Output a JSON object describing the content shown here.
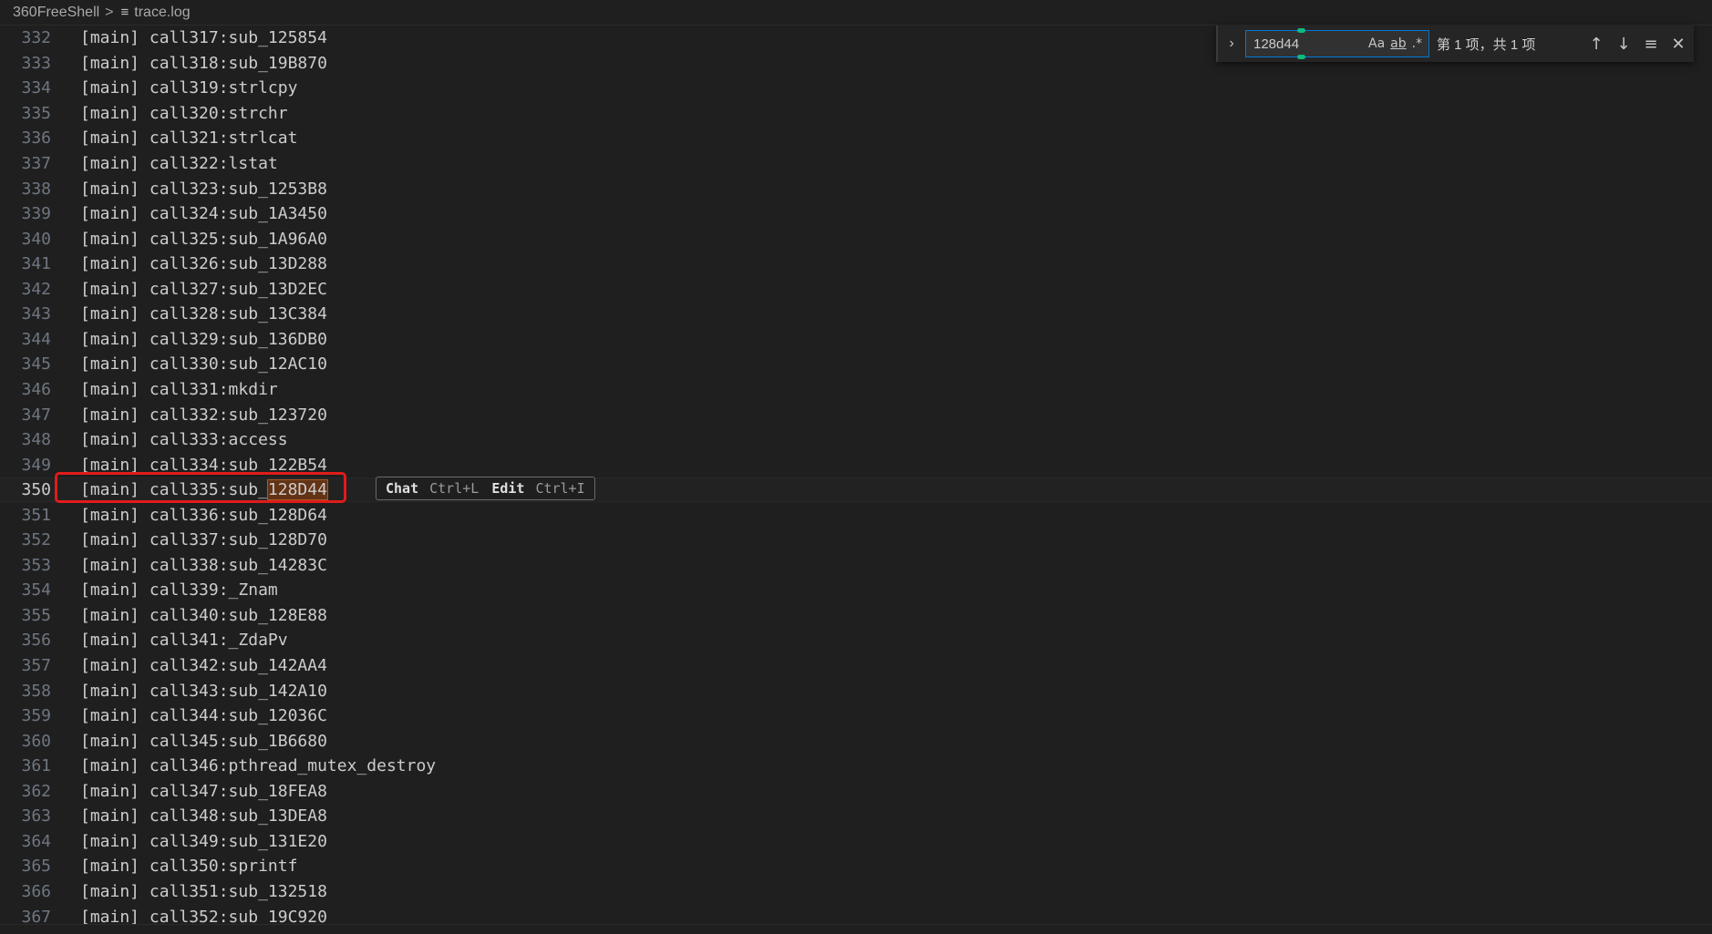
{
  "breadcrumb": {
    "folder": "360FreeShell",
    "separator": ">",
    "file_icon": "≡",
    "file": "trace.log"
  },
  "find": {
    "toggle_icon": "›",
    "query": "128d44",
    "opt_case": "Aa",
    "opt_word": "ab",
    "opt_regex": ".*",
    "count": "第 1 项，共 1 项",
    "prev_icon": "↑",
    "next_icon": "↓",
    "selection_icon": "≡",
    "close_icon": "✕"
  },
  "inline_hint": {
    "chat_label": "Chat",
    "chat_key": "Ctrl+L",
    "edit_label": "Edit",
    "edit_key": "Ctrl+I"
  },
  "current_line_match": {
    "prefix": "[main] call335:sub_",
    "match": "128D44"
  },
  "lines": [
    {
      "num": "332",
      "text": "[main] call317:sub_125854"
    },
    {
      "num": "333",
      "text": "[main] call318:sub_19B870"
    },
    {
      "num": "334",
      "text": "[main] call319:strlcpy"
    },
    {
      "num": "335",
      "text": "[main] call320:strchr"
    },
    {
      "num": "336",
      "text": "[main] call321:strlcat"
    },
    {
      "num": "337",
      "text": "[main] call322:lstat"
    },
    {
      "num": "338",
      "text": "[main] call323:sub_1253B8"
    },
    {
      "num": "339",
      "text": "[main] call324:sub_1A3450"
    },
    {
      "num": "340",
      "text": "[main] call325:sub_1A96A0"
    },
    {
      "num": "341",
      "text": "[main] call326:sub_13D288"
    },
    {
      "num": "342",
      "text": "[main] call327:sub_13D2EC"
    },
    {
      "num": "343",
      "text": "[main] call328:sub_13C384"
    },
    {
      "num": "344",
      "text": "[main] call329:sub_136DB0"
    },
    {
      "num": "345",
      "text": "[main] call330:sub_12AC10"
    },
    {
      "num": "346",
      "text": "[main] call331:mkdir"
    },
    {
      "num": "347",
      "text": "[main] call332:sub_123720"
    },
    {
      "num": "348",
      "text": "[main] call333:access"
    },
    {
      "num": "349",
      "text": "[main] call334:sub_122B54"
    },
    {
      "num": "350",
      "text": "[main] call335:sub_128D44",
      "current": true
    },
    {
      "num": "351",
      "text": "[main] call336:sub_128D64"
    },
    {
      "num": "352",
      "text": "[main] call337:sub_128D70"
    },
    {
      "num": "353",
      "text": "[main] call338:sub_14283C"
    },
    {
      "num": "354",
      "text": "[main] call339:_Znam"
    },
    {
      "num": "355",
      "text": "[main] call340:sub_128E88"
    },
    {
      "num": "356",
      "text": "[main] call341:_ZdaPv"
    },
    {
      "num": "357",
      "text": "[main] call342:sub_142AA4"
    },
    {
      "num": "358",
      "text": "[main] call343:sub_142A10"
    },
    {
      "num": "359",
      "text": "[main] call344:sub_12036C"
    },
    {
      "num": "360",
      "text": "[main] call345:sub_1B6680"
    },
    {
      "num": "361",
      "text": "[main] call346:pthread_mutex_destroy"
    },
    {
      "num": "362",
      "text": "[main] call347:sub_18FEA8"
    },
    {
      "num": "363",
      "text": "[main] call348:sub_13DEA8"
    },
    {
      "num": "364",
      "text": "[main] call349:sub_131E20"
    },
    {
      "num": "365",
      "text": "[main] call350:sprintf"
    },
    {
      "num": "366",
      "text": "[main] call351:sub_132518"
    },
    {
      "num": "367",
      "text": "[main] call352:sub_19C920"
    }
  ]
}
